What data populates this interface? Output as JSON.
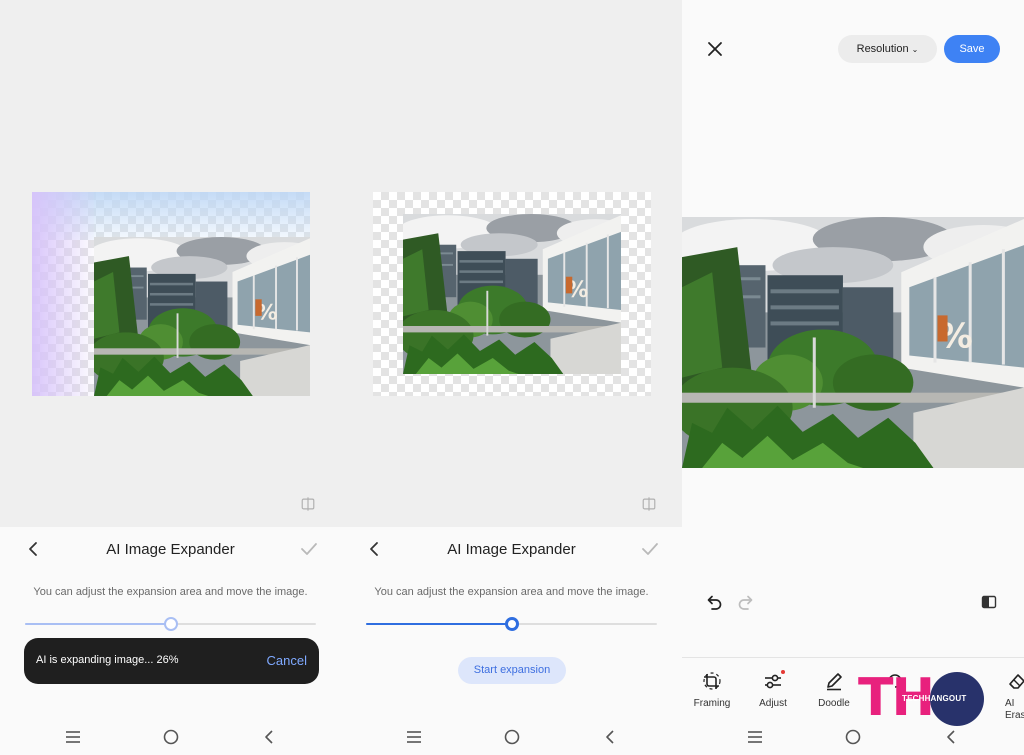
{
  "expander_screen": {
    "title": "AI Image Expander",
    "hint": "You can adjust the expansion area and move the image.",
    "slider_level": 0.5
  },
  "progress_toast": {
    "text": "AI is expanding image... 26%",
    "cancel_label": "Cancel"
  },
  "start_button_label": "Start expansion",
  "editor": {
    "resolution_label": "Resolution",
    "save_label": "Save",
    "tools": [
      {
        "label": "Framing",
        "icon": "framing-icon"
      },
      {
        "label": "Adjust",
        "icon": "adjust-icon"
      },
      {
        "label": "Doodle",
        "icon": "pencil-icon"
      },
      {
        "label": "",
        "icon": "rotate-icon"
      },
      {
        "label": "",
        "icon": "sticker-icon"
      },
      {
        "label": "AI Eras",
        "icon": "eraser-icon"
      }
    ]
  },
  "nav_icons": [
    "recent-apps-icon",
    "home-icon",
    "back-icon"
  ],
  "watermark": {
    "letters": "TH",
    "text": "TECHHANGOUT"
  },
  "colors": {
    "accent": "#3e82f4",
    "slider_light": "#a9bff4",
    "slider_active": "#2f6ee0",
    "toast_bg": "#1f1f1f",
    "toast_cancel": "#7fa9ff",
    "watermark_pink": "#e8217d",
    "watermark_navy": "#28326b"
  }
}
